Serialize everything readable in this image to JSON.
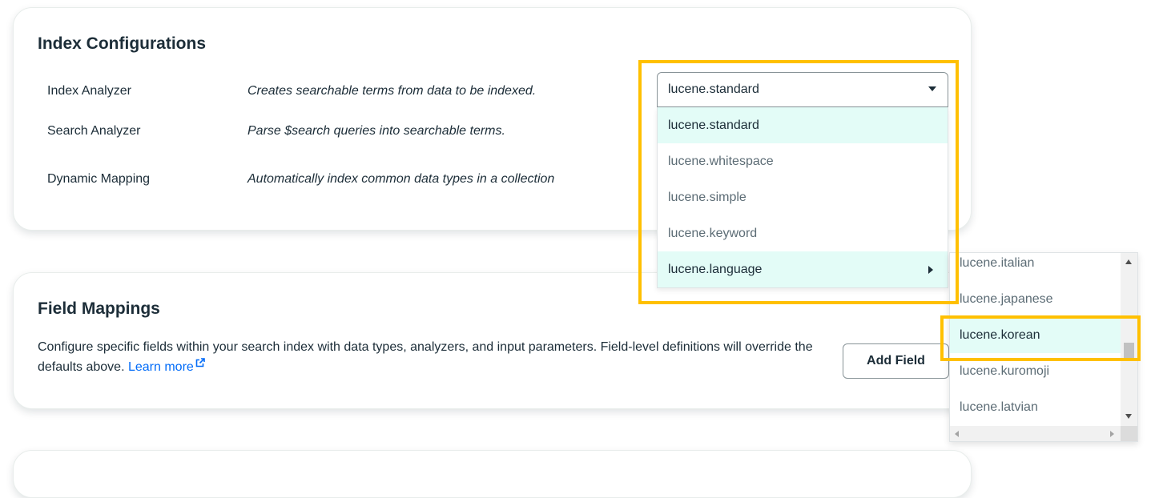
{
  "index_config": {
    "title": "Index Configurations",
    "rows": [
      {
        "label": "Index Analyzer",
        "description": "Creates searchable terms from data to be indexed."
      },
      {
        "label": "Search Analyzer",
        "description": "Parse $search queries into searchable terms."
      },
      {
        "label": "Dynamic Mapping",
        "description": "Automatically index common data types in a collection"
      }
    ]
  },
  "analyzer_select": {
    "value": "lucene.standard",
    "options": [
      "lucene.standard",
      "lucene.whitespace",
      "lucene.simple",
      "lucene.keyword",
      "lucene.language"
    ]
  },
  "language_submenu": {
    "options": [
      "lucene.italian",
      "lucene.japanese",
      "lucene.korean",
      "lucene.kuromoji",
      "lucene.latvian"
    ],
    "highlighted": "lucene.korean"
  },
  "field_mappings": {
    "title": "Field Mappings",
    "description": "Configure specific fields within your search index with data types, analyzers, and input parameters. Field-level definitions will override the defaults above.",
    "learn_more": "Learn more",
    "add_field_label": "Add Field"
  },
  "colors": {
    "highlight_box": "#ffc000",
    "active_item_bg": "#e3fcf7",
    "link": "#016bf8"
  }
}
